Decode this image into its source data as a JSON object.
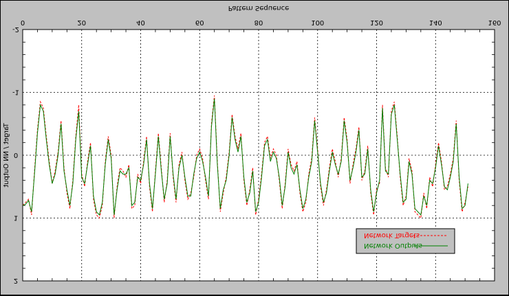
{
  "colors": {
    "background": "#c0c0c0",
    "plot_background": "#ffffff",
    "targets": "#ff0000",
    "outputs": "#008000",
    "grid": "#000000"
  },
  "chart_data": {
    "type": "line",
    "orientation": "image flipped vertically (upside-down render)",
    "title": "Pattern Sequence",
    "xlabel": "",
    "ylabel": "Target / NN Output",
    "xlim": [
      0,
      160
    ],
    "ylim": [
      -2,
      2
    ],
    "y_axis_direction": "-2 at top, 2 at bottom",
    "x_ticks": [
      0,
      20,
      40,
      60,
      80,
      100,
      120,
      140,
      160
    ],
    "y_ticks": [
      -2,
      -1,
      0,
      1,
      2
    ],
    "grid": true,
    "legend_position": "bottom-right",
    "series": [
      {
        "name": "Network Targets",
        "style": "dashed",
        "color": "#ff0000",
        "values": [
          0.8,
          0.75,
          0.7,
          0.95,
          0.25,
          -0.4,
          -0.85,
          -0.75,
          -0.3,
          0.1,
          0.45,
          0.25,
          -0.05,
          -0.55,
          0.2,
          0.6,
          0.85,
          0.4,
          -0.3,
          -0.8,
          0.3,
          0.5,
          0.1,
          -0.2,
          0.7,
          0.95,
          1.0,
          0.8,
          0.1,
          -0.3,
          0.0,
          1.0,
          0.5,
          0.2,
          0.25,
          0.35,
          0.15,
          0.85,
          0.8,
          0.3,
          0.45,
          0.1,
          -0.3,
          0.5,
          0.9,
          0.25,
          -0.35,
          0.2,
          0.75,
          0.4,
          -0.35,
          0.35,
          0.75,
          0.15,
          -0.05,
          0.4,
          0.7,
          0.6,
          0.35,
          0.0,
          -0.1,
          0.05,
          0.4,
          0.7,
          -0.5,
          -0.95,
          0.1,
          0.9,
          0.6,
          0.35,
          -0.05,
          -0.65,
          -0.3,
          -0.1,
          -0.35,
          0.4,
          0.8,
          0.55,
          0.2,
          0.95,
          0.7,
          0.3,
          -0.2,
          -0.3,
          0.05,
          -0.1,
          0.0,
          0.4,
          0.85,
          0.45,
          -0.1,
          0.15,
          0.25,
          0.1,
          0.6,
          0.9,
          0.75,
          0.3,
          0.05,
          -0.6,
          -0.1,
          0.5,
          0.8,
          0.55,
          0.2,
          -0.1,
          0.1,
          0.35,
          0.05,
          -0.6,
          -0.25,
          0.45,
          0.15,
          -0.1,
          -0.45,
          0.4,
          0.25,
          -0.15,
          0.6,
          0.95,
          0.55,
          0.45,
          -0.8,
          0.2,
          0.35,
          -0.7,
          -0.85,
          -0.3,
          0.35,
          0.8,
          0.65,
          0.05,
          0.25,
          0.9,
          0.95,
          1.0,
          0.6,
          0.85,
          0.35,
          0.5,
          0.15,
          -0.2,
          0.1,
          0.55,
          0.5,
          0.3,
          0.05,
          -0.55,
          0.4,
          0.9,
          0.75,
          0.5
        ],
        "values_note": "approximate, flipped axis values"
      },
      {
        "name": "Network Outputs",
        "style": "solid",
        "color": "#008000",
        "values": [
          0.8,
          0.78,
          0.72,
          0.9,
          0.3,
          -0.35,
          -0.8,
          -0.7,
          -0.25,
          0.15,
          0.45,
          0.3,
          0.0,
          -0.5,
          0.25,
          0.55,
          0.8,
          0.45,
          -0.25,
          -0.7,
          0.35,
          0.45,
          0.15,
          -0.15,
          0.65,
          0.9,
          0.95,
          0.75,
          0.15,
          -0.25,
          0.05,
          0.95,
          0.55,
          0.25,
          0.3,
          0.3,
          0.2,
          0.8,
          0.75,
          0.35,
          0.4,
          0.15,
          -0.25,
          0.45,
          0.85,
          0.3,
          -0.3,
          0.25,
          0.7,
          0.45,
          -0.3,
          0.3,
          0.7,
          0.2,
          0.0,
          0.35,
          0.65,
          0.65,
          0.3,
          0.05,
          -0.05,
          0.1,
          0.35,
          0.65,
          -0.45,
          -0.9,
          0.15,
          0.85,
          0.55,
          0.4,
          0.0,
          -0.6,
          -0.25,
          -0.05,
          -0.3,
          0.35,
          0.75,
          0.6,
          0.25,
          0.9,
          0.75,
          0.35,
          -0.15,
          -0.25,
          0.1,
          -0.05,
          0.05,
          0.35,
          0.8,
          0.5,
          -0.05,
          0.2,
          0.3,
          0.15,
          0.55,
          0.85,
          0.7,
          0.35,
          0.1,
          -0.55,
          -0.05,
          0.45,
          0.75,
          0.6,
          0.25,
          -0.05,
          0.15,
          0.3,
          0.1,
          -0.55,
          -0.2,
          0.4,
          0.2,
          -0.05,
          -0.4,
          0.35,
          0.3,
          -0.1,
          0.55,
          0.9,
          0.6,
          0.4,
          -0.75,
          0.25,
          0.3,
          -0.65,
          -0.8,
          -0.25,
          0.3,
          0.75,
          0.7,
          0.1,
          0.3,
          0.85,
          0.9,
          0.95,
          0.65,
          0.8,
          0.4,
          0.45,
          0.2,
          -0.15,
          0.15,
          0.5,
          0.55,
          0.35,
          0.1,
          -0.5,
          0.35,
          0.85,
          0.8,
          0.45
        ],
        "values_note": "approximate, flipped axis values"
      }
    ]
  }
}
